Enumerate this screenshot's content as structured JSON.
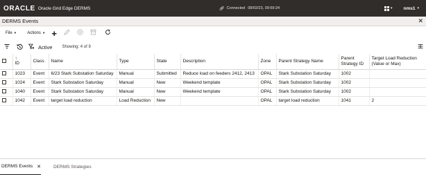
{
  "header": {
    "logo": "ORACLE",
    "product": "Oracle Grid Edge DERMS",
    "connection_status": "Connected",
    "connection_time": "08/02/23, 09:59:24",
    "apps_icon": "grid-icon",
    "user": "nms1"
  },
  "panel": {
    "title": "DERMS Events"
  },
  "toolbar": {
    "file_label": "File",
    "actions_label": "Actions"
  },
  "filterbar": {
    "active_label": "Active",
    "showing_text": "Showing: 4 of 9"
  },
  "table": {
    "columns": [
      "",
      "ID",
      "Class",
      "Name",
      "Type",
      "State",
      "Description",
      "Zone",
      "Parent Strategy Name",
      "Parent Strategy ID",
      "Target Load Reduction (Value or Max)"
    ],
    "rows": [
      {
        "id": "1023",
        "class": "Event",
        "name": "6/23 Stark Substation Saturday",
        "type": "Manual",
        "state": "Submitted",
        "description": "Reduce load on feeders 2412, 2413",
        "zone": "OPAL",
        "parent_name": "Stark Substation Saturday",
        "parent_id": "1002",
        "target": ""
      },
      {
        "id": "1024",
        "class": "Event",
        "name": "Stark Substation Saturday",
        "type": "Manual",
        "state": "New",
        "description": "Weekend template",
        "zone": "OPAL",
        "parent_name": "Stark Substation Saturday",
        "parent_id": "1002",
        "target": ""
      },
      {
        "id": "1040",
        "class": "Event",
        "name": "Stark Substation Saturday",
        "type": "Manual",
        "state": "New",
        "description": "Weekend template",
        "zone": "OPAL",
        "parent_name": "Stark Substation Saturday",
        "parent_id": "1002",
        "target": ""
      },
      {
        "id": "1042",
        "class": "Event",
        "name": "target load reduction",
        "type": "Load Reduction",
        "state": "New",
        "description": "",
        "zone": "OPAL",
        "parent_name": "target load reduction",
        "parent_id": "1041",
        "target": "2"
      }
    ]
  },
  "bottom_tabs": [
    {
      "label": "DERMS Events",
      "active": true
    },
    {
      "label": "DERMS Strategies",
      "active": false
    }
  ]
}
